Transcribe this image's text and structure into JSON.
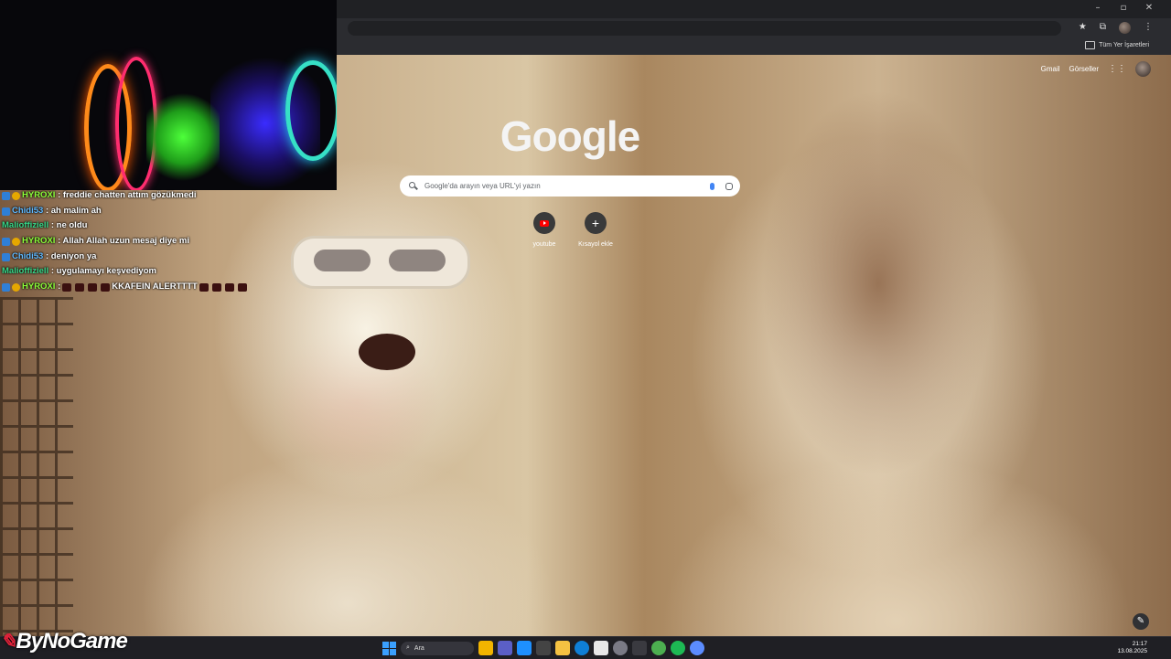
{
  "window": {
    "minimize_glyph": "–",
    "maximize_glyph": "▫",
    "close_glyph": "✕"
  },
  "toolbar": {
    "icons": [
      "star-icon",
      "extensions-icon",
      "avatar",
      "menu-icon"
    ],
    "star": "★",
    "ext": "⧉",
    "menu": "⋮"
  },
  "bookmarks": {
    "all_label": "Tüm Yer İşaretleri"
  },
  "ntp": {
    "logo": "Google",
    "links": {
      "gmail": "Gmail",
      "images": "Görseller"
    },
    "search_placeholder": "Google'da arayın veya URL'yi yazın",
    "shortcuts": [
      {
        "label": "youtube",
        "icon": "youtube-icon"
      },
      {
        "label": "Kısayol ekle",
        "icon": "plus-icon",
        "glyph": "+"
      }
    ],
    "edit_glyph": "✎"
  },
  "chat": [
    {
      "user": "HYROXI",
      "badges": [
        "sub",
        "coin"
      ],
      "text": ": freddie chatten attım gözükmedi",
      "color": "#8dff3a"
    },
    {
      "user": "Chidi53",
      "badges": [
        "sub"
      ],
      "text": ": ah malim ah",
      "color": "#5fb9ff"
    },
    {
      "user": "Malioffiziell",
      "badges": [],
      "text": ": ne oldu",
      "color": "#37d98a"
    },
    {
      "user": "HYROXI",
      "badges": [
        "sub",
        "coin"
      ],
      "text": ": Allah Allah uzun mesaj diye mi",
      "color": "#8dff3a"
    },
    {
      "user": "Chidi53",
      "badges": [
        "sub"
      ],
      "text": ": deniyon ya",
      "color": "#5fb9ff"
    },
    {
      "user": "Malioffiziell",
      "badges": [],
      "text": ": uygulamayı keşvediyom",
      "color": "#37d98a"
    },
    {
      "user": "HYROXI",
      "badges": [
        "sub",
        "coin"
      ],
      "text_before": ":",
      "text": "KKAFEIN ALERTTTT",
      "color": "#8dff3a"
    }
  ],
  "brand": {
    "name": "ByNoGame"
  },
  "taskbar": {
    "search_label": "Ara",
    "time": "21:17",
    "date": "13.08.2025"
  }
}
